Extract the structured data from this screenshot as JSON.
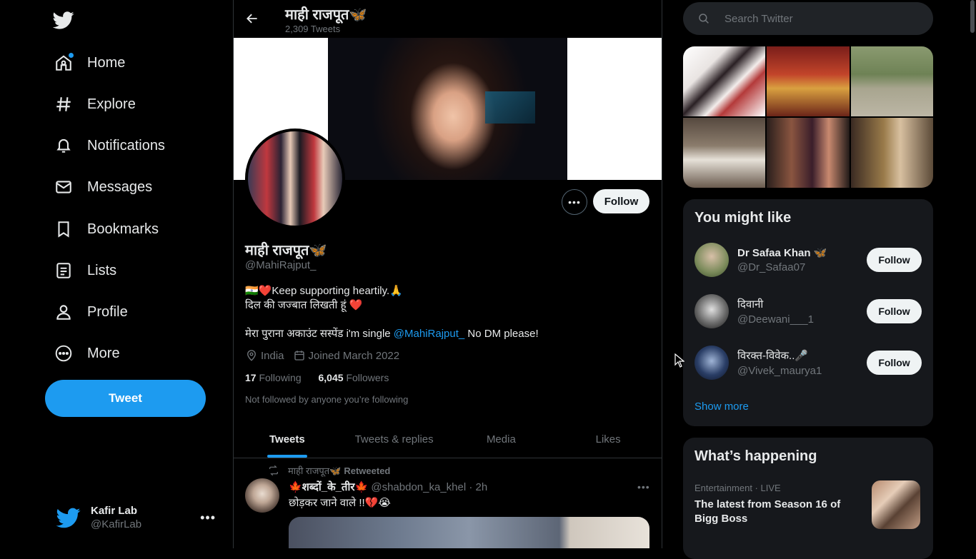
{
  "nav": {
    "items": [
      {
        "label": "Home",
        "icon": "home-icon"
      },
      {
        "label": "Explore",
        "icon": "hashtag-icon"
      },
      {
        "label": "Notifications",
        "icon": "bell-icon"
      },
      {
        "label": "Messages",
        "icon": "envelope-icon"
      },
      {
        "label": "Bookmarks",
        "icon": "bookmark-icon"
      },
      {
        "label": "Lists",
        "icon": "list-icon"
      },
      {
        "label": "Profile",
        "icon": "person-icon"
      },
      {
        "label": "More",
        "icon": "more-circle-icon"
      }
    ],
    "tweet_button": "Tweet"
  },
  "account": {
    "name": "Kafir Lab",
    "handle": "@KafirLab"
  },
  "header": {
    "name": "माही राजपूत🦋",
    "tweet_count": "2,309 Tweets"
  },
  "profile": {
    "follow_label": "Follow",
    "name": "माही राजपूत🦋",
    "handle": "@MahiRajput_",
    "bio_line1": "🇮🇳❤️Keep supporting heartily.🙏",
    "bio_line2": "दिल की  जज्बात लिखती हूं ❤️",
    "bio_line3_pre": "मेरा पुराना अकाउंट सस्पेंड i'm single ",
    "bio_line3_mention": "@MahiRajput_",
    "bio_line3_post": " No DM please!",
    "location": "India",
    "joined": "Joined March 2022",
    "following_count": "17",
    "following_label": "Following",
    "followers_count": "6,045",
    "followers_label": "Followers",
    "not_followed": "Not followed by anyone you’re following"
  },
  "tabs": [
    "Tweets",
    "Tweets & replies",
    "Media",
    "Likes"
  ],
  "tweet": {
    "retweeted_by": "माही राजपूत🦋",
    "retweeted_label": "Retweeted",
    "author_name": "🍁शब्दों_के_तीर🍁",
    "author_handle": "@shabdon_ka_khel",
    "time": "· 2h",
    "text": "छोड़कर जाने वाले !!💔😭"
  },
  "search": {
    "placeholder": "Search Twitter"
  },
  "you_might_like": {
    "title": "You might like",
    "users": [
      {
        "name": "Dr Safaa Khan 🦋",
        "handle": "@Dr_Safaa07",
        "follow": "Follow"
      },
      {
        "name": "दिवानी",
        "handle": "@Deewani___1",
        "follow": "Follow"
      },
      {
        "name": "विरक्त-विवेक..🎤",
        "handle": "@Vivek_maurya1",
        "follow": "Follow"
      }
    ],
    "show_more": "Show more"
  },
  "whats_happening": {
    "title": "What’s happening",
    "trend_meta": "Entertainment · LIVE",
    "trend_title": "The latest from Season 16 of Bigg Boss"
  },
  "colors": {
    "accent": "#1d9bf0",
    "background": "#000000",
    "muted": "#71767b"
  }
}
